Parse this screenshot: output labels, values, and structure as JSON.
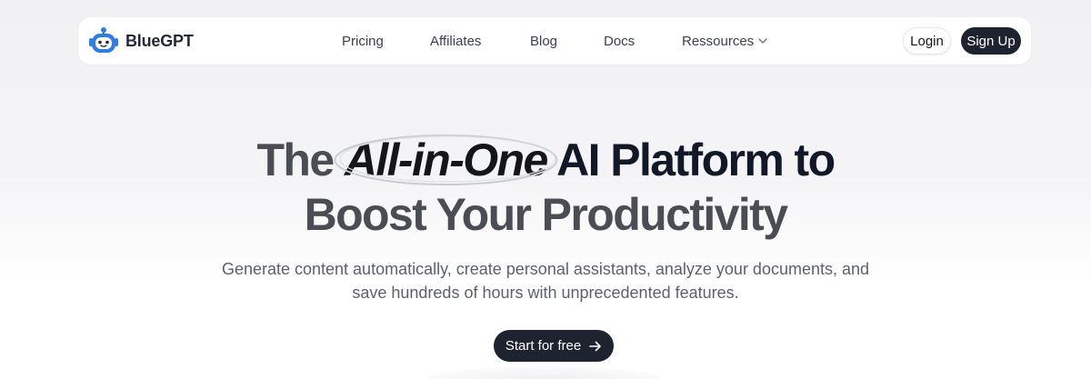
{
  "brand": {
    "name": "BlueGPT",
    "logo_icon": "robot-head-icon",
    "accent": "#2f7de1"
  },
  "nav": {
    "links": [
      "Pricing",
      "Affiliates",
      "Blog",
      "Docs",
      "Ressources"
    ],
    "resources_icon": "chevron-down-icon",
    "login_label": "Login",
    "signup_label": "Sign Up"
  },
  "hero": {
    "title_line1_start": "The",
    "title_emphasis": "All-in-One",
    "title_line1_end": "AI Platform to",
    "title_line2": "Boost Your Productivity",
    "subtitle_line1": "Generate content automatically, create personal assistants, analyze your documents, and",
    "subtitle_line2": "save hundreds of hours with unprecedented features.",
    "cta_label": "Start for free",
    "cta_icon": "arrow-right-icon"
  },
  "colors": {
    "dark": "#1d2430",
    "text": "#111827",
    "muted": "#5b6170"
  }
}
